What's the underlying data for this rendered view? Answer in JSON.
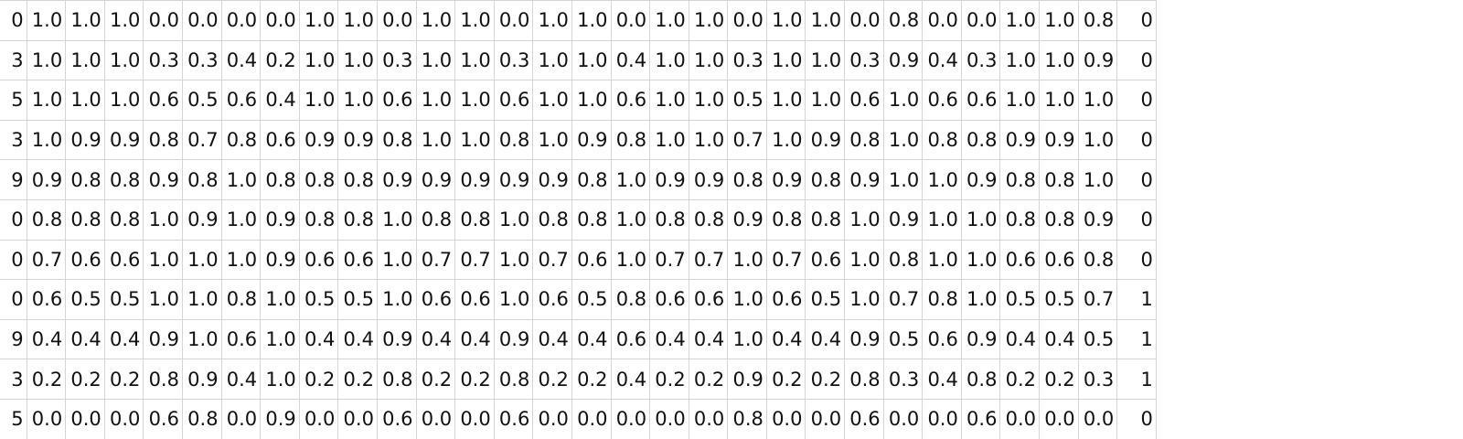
{
  "sheet": {
    "rows": [
      [
        "0",
        "1.0",
        "1.0",
        "1.0",
        "0.0",
        "0.0",
        "0.0",
        "0.0",
        "1.0",
        "1.0",
        "0.0",
        "1.0",
        "1.0",
        "0.0",
        "1.0",
        "1.0",
        "0.0",
        "1.0",
        "1.0",
        "0.0",
        "1.0",
        "1.0",
        "0.0",
        "0.8",
        "0.0",
        "0.0",
        "1.0",
        "1.0",
        "0.8",
        "0"
      ],
      [
        "3",
        "1.0",
        "1.0",
        "1.0",
        "0.3",
        "0.3",
        "0.4",
        "0.2",
        "1.0",
        "1.0",
        "0.3",
        "1.0",
        "1.0",
        "0.3",
        "1.0",
        "1.0",
        "0.4",
        "1.0",
        "1.0",
        "0.3",
        "1.0",
        "1.0",
        "0.3",
        "0.9",
        "0.4",
        "0.3",
        "1.0",
        "1.0",
        "0.9",
        "0"
      ],
      [
        "5",
        "1.0",
        "1.0",
        "1.0",
        "0.6",
        "0.5",
        "0.6",
        "0.4",
        "1.0",
        "1.0",
        "0.6",
        "1.0",
        "1.0",
        "0.6",
        "1.0",
        "1.0",
        "0.6",
        "1.0",
        "1.0",
        "0.5",
        "1.0",
        "1.0",
        "0.6",
        "1.0",
        "0.6",
        "0.6",
        "1.0",
        "1.0",
        "1.0",
        "0"
      ],
      [
        "3",
        "1.0",
        "0.9",
        "0.9",
        "0.8",
        "0.7",
        "0.8",
        "0.6",
        "0.9",
        "0.9",
        "0.8",
        "1.0",
        "1.0",
        "0.8",
        "1.0",
        "0.9",
        "0.8",
        "1.0",
        "1.0",
        "0.7",
        "1.0",
        "0.9",
        "0.8",
        "1.0",
        "0.8",
        "0.8",
        "0.9",
        "0.9",
        "1.0",
        "0"
      ],
      [
        "9",
        "0.9",
        "0.8",
        "0.8",
        "0.9",
        "0.8",
        "1.0",
        "0.8",
        "0.8",
        "0.8",
        "0.9",
        "0.9",
        "0.9",
        "0.9",
        "0.9",
        "0.8",
        "1.0",
        "0.9",
        "0.9",
        "0.8",
        "0.9",
        "0.8",
        "0.9",
        "1.0",
        "1.0",
        "0.9",
        "0.8",
        "0.8",
        "1.0",
        "0"
      ],
      [
        "0",
        "0.8",
        "0.8",
        "0.8",
        "1.0",
        "0.9",
        "1.0",
        "0.9",
        "0.8",
        "0.8",
        "1.0",
        "0.8",
        "0.8",
        "1.0",
        "0.8",
        "0.8",
        "1.0",
        "0.8",
        "0.8",
        "0.9",
        "0.8",
        "0.8",
        "1.0",
        "0.9",
        "1.0",
        "1.0",
        "0.8",
        "0.8",
        "0.9",
        "0"
      ],
      [
        "0",
        "0.7",
        "0.6",
        "0.6",
        "1.0",
        "1.0",
        "1.0",
        "0.9",
        "0.6",
        "0.6",
        "1.0",
        "0.7",
        "0.7",
        "1.0",
        "0.7",
        "0.6",
        "1.0",
        "0.7",
        "0.7",
        "1.0",
        "0.7",
        "0.6",
        "1.0",
        "0.8",
        "1.0",
        "1.0",
        "0.6",
        "0.6",
        "0.8",
        "0"
      ],
      [
        "0",
        "0.6",
        "0.5",
        "0.5",
        "1.0",
        "1.0",
        "0.8",
        "1.0",
        "0.5",
        "0.5",
        "1.0",
        "0.6",
        "0.6",
        "1.0",
        "0.6",
        "0.5",
        "0.8",
        "0.6",
        "0.6",
        "1.0",
        "0.6",
        "0.5",
        "1.0",
        "0.7",
        "0.8",
        "1.0",
        "0.5",
        "0.5",
        "0.7",
        "1"
      ],
      [
        "9",
        "0.4",
        "0.4",
        "0.4",
        "0.9",
        "1.0",
        "0.6",
        "1.0",
        "0.4",
        "0.4",
        "0.9",
        "0.4",
        "0.4",
        "0.9",
        "0.4",
        "0.4",
        "0.6",
        "0.4",
        "0.4",
        "1.0",
        "0.4",
        "0.4",
        "0.9",
        "0.5",
        "0.6",
        "0.9",
        "0.4",
        "0.4",
        "0.5",
        "1"
      ],
      [
        "3",
        "0.2",
        "0.2",
        "0.2",
        "0.8",
        "0.9",
        "0.4",
        "1.0",
        "0.2",
        "0.2",
        "0.8",
        "0.2",
        "0.2",
        "0.8",
        "0.2",
        "0.2",
        "0.4",
        "0.2",
        "0.2",
        "0.9",
        "0.2",
        "0.2",
        "0.8",
        "0.3",
        "0.4",
        "0.8",
        "0.2",
        "0.2",
        "0.3",
        "1"
      ],
      [
        "5",
        "0.0",
        "0.0",
        "0.0",
        "0.6",
        "0.8",
        "0.0",
        "0.9",
        "0.0",
        "0.0",
        "0.6",
        "0.0",
        "0.0",
        "0.6",
        "0.0",
        "0.0",
        "0.0",
        "0.0",
        "0.0",
        "0.8",
        "0.0",
        "0.0",
        "0.6",
        "0.0",
        "0.0",
        "0.6",
        "0.0",
        "0.0",
        "0.0",
        "0"
      ]
    ]
  },
  "colors": {
    "gridline": "#d4d4d4",
    "text": "#111111",
    "background": "#ffffff"
  }
}
